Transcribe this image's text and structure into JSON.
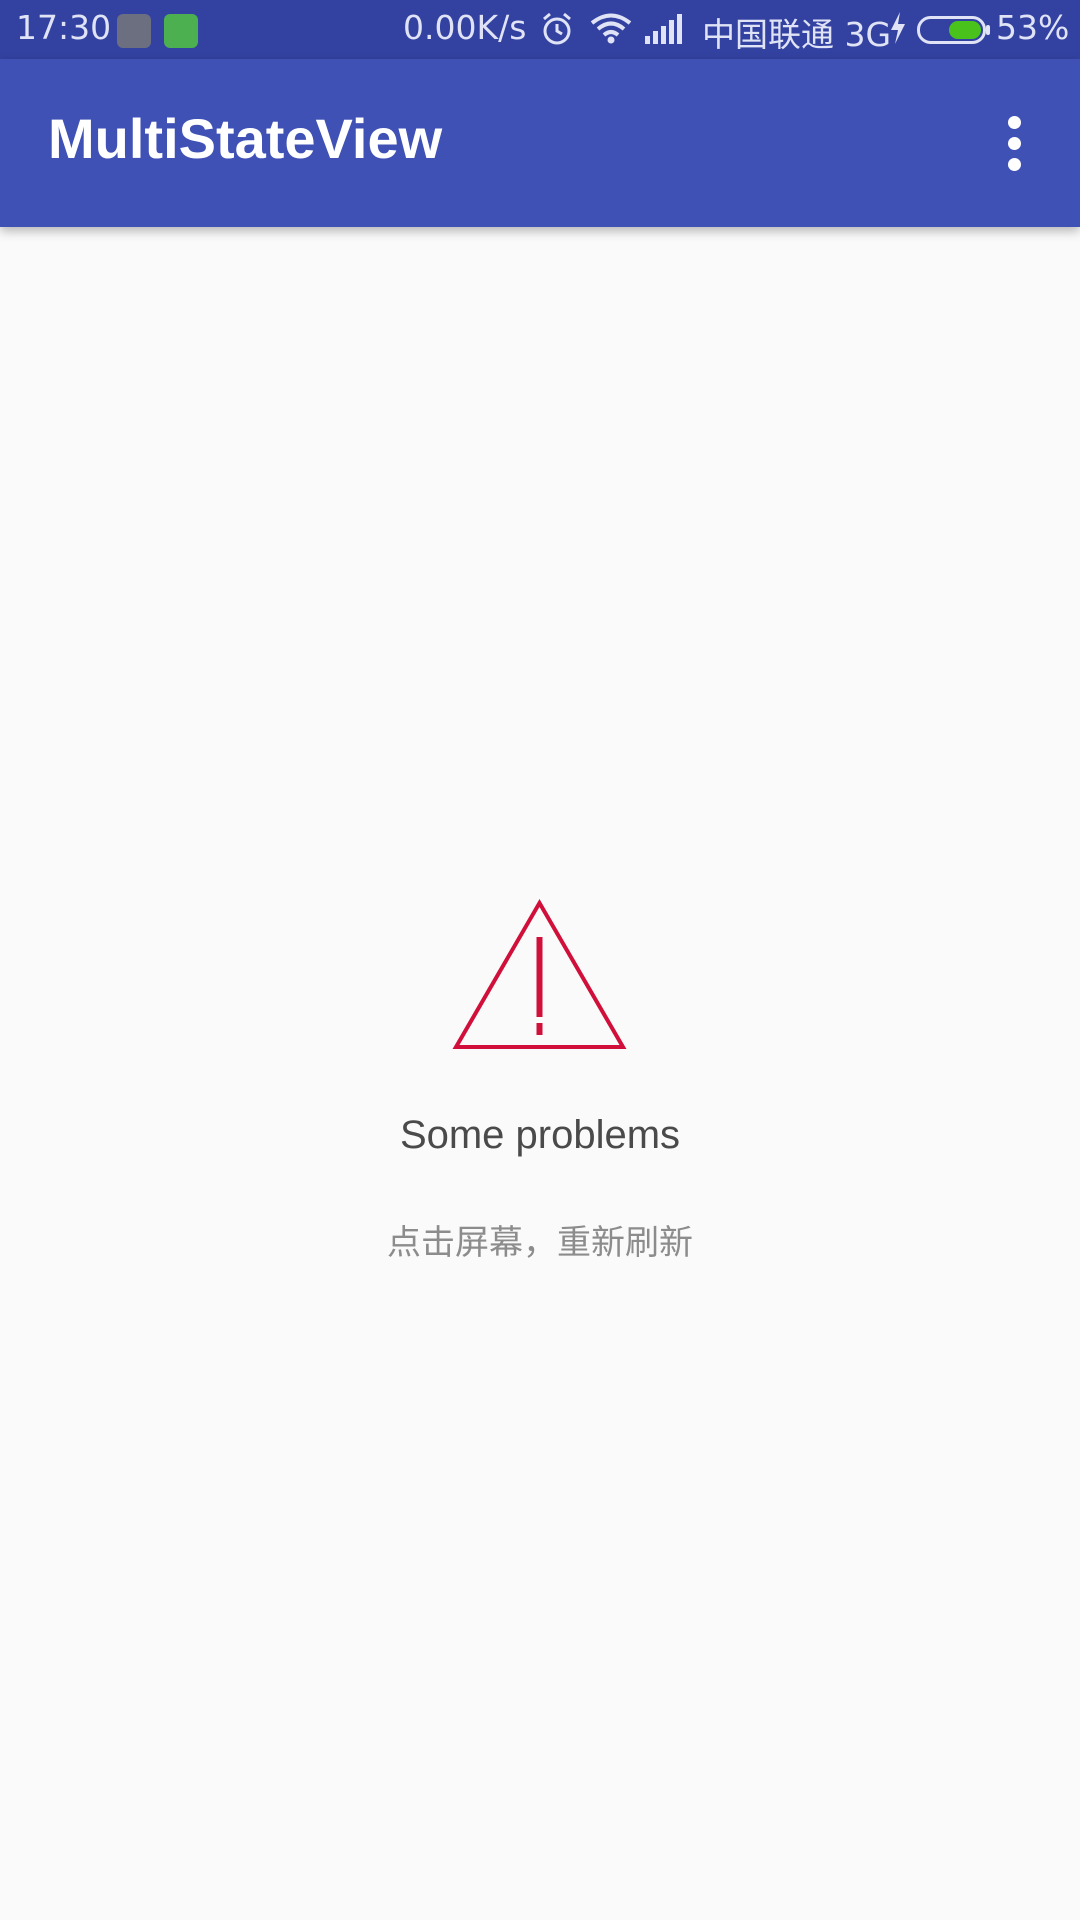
{
  "status_bar": {
    "time": "17:30",
    "network_speed": "0.00K/s",
    "carrier": "中国联通 3G",
    "battery_percent": "53%",
    "battery_level": 0.53,
    "icons": [
      "notification-app-icon",
      "notification-android-icon",
      "alarm-icon",
      "wifi-icon",
      "cell-signal-icon",
      "charging-icon",
      "battery-icon"
    ]
  },
  "app_bar": {
    "title": "MultiStateView",
    "overflow_icon": "more-vert-icon",
    "background_color": "#3f51b5"
  },
  "error_state": {
    "icon": "warning-triangle-icon",
    "icon_color": "#d0103a",
    "title": "Some problems",
    "subtitle": "点击屏幕，重新刷新"
  }
}
